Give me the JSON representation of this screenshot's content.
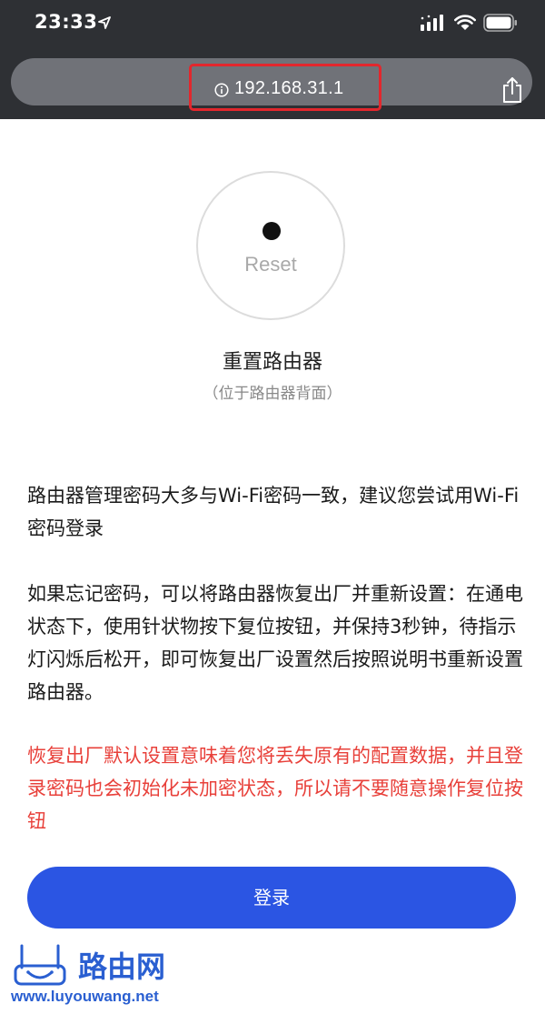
{
  "status_bar": {
    "time": "23:33",
    "icons": [
      "location-arrow-icon",
      "signal-icon",
      "wifi-icon",
      "battery-icon"
    ]
  },
  "browser": {
    "url": "192.168.31.1",
    "info_icon": "info-icon",
    "share_icon": "share-icon",
    "highlight_color": "#e2272d"
  },
  "reset": {
    "button_label": "Reset",
    "title": "重置路由器",
    "subtitle": "（位于路由器背面）"
  },
  "content": {
    "paragraph1": "路由器管理密码大多与Wi-Fi密码一致，建议您尝试用Wi-Fi密码登录",
    "paragraph2": "如果忘记密码，可以将路由器恢复出厂并重新设置：在通电状态下，使用针状物按下复位按钮，并保持3秒钟，待指示灯闪烁后松开，即可恢复出厂设置然后按照说明书重新设置路由器。",
    "warning": "恢复出厂默认设置意味着您将丢失原有的配置数据，并且登录密码也会初始化未加密状态，所以请不要随意操作复位按钮"
  },
  "login_button": {
    "label": "登录"
  },
  "watermark": {
    "logo_text": "路由网",
    "url": "www.luyouwang.net"
  },
  "colors": {
    "browser_chrome": "#2e3034",
    "url_field": "#707278",
    "button_blue": "#2b55e3",
    "warning_red": "#e8403a",
    "watermark_blue": "#2a5fd1"
  }
}
